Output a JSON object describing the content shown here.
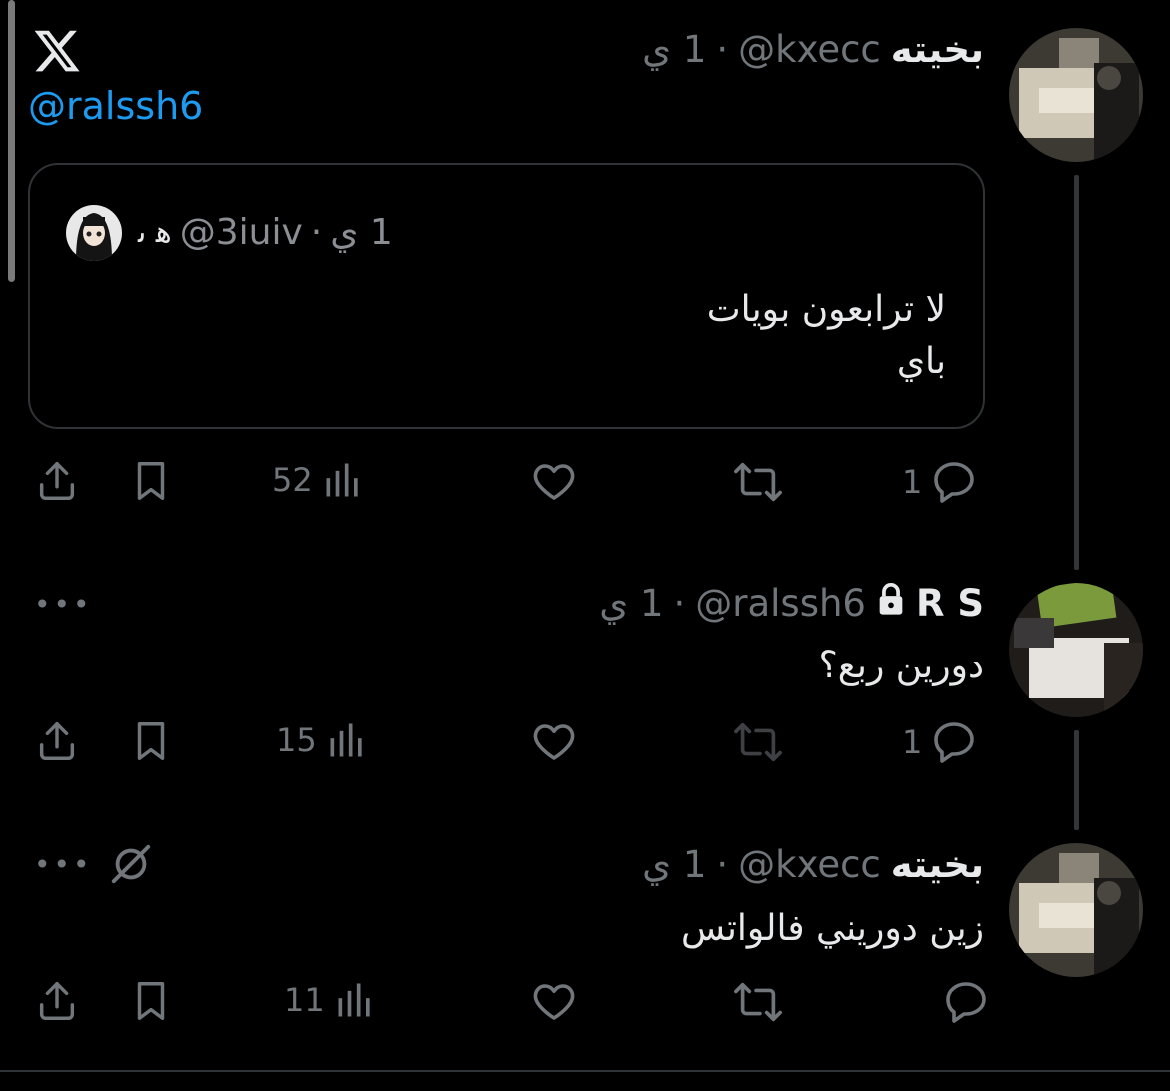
{
  "reply_to": "@ralssh6",
  "tweets": [
    {
      "display_name": "بخيته",
      "handle": "@kxecc",
      "separator": "·",
      "time": "1 ي",
      "quote": {
        "handle": "@3iuiv",
        "display_name": "ﻫ ﯨ",
        "time": "1 ي",
        "text": "لا ترابعون بويات\nباي"
      },
      "stats": {
        "replies": "1",
        "retweets": "",
        "likes": "",
        "views": "52"
      }
    },
    {
      "display_name": "R S",
      "handle": "@ralssh6",
      "separator": "·",
      "time": "1 ي",
      "protected": true,
      "text": "دورين ربع؟",
      "stats": {
        "replies": "1",
        "retweets": "",
        "likes": "",
        "views": "15"
      }
    },
    {
      "display_name": "بخيته",
      "handle": "@kxecc",
      "separator": "·",
      "time": "1 ي",
      "text": "زين دوريني فالواتس",
      "stats": {
        "replies": "",
        "retweets": "",
        "likes": "",
        "views": "11"
      }
    }
  ],
  "more_label": "•••",
  "icons": {
    "logo": "x-logo-icon",
    "reply": "reply-icon",
    "retweet": "retweet-icon",
    "like": "heart-icon",
    "views": "views-icon",
    "bookmark": "bookmark-icon",
    "share": "share-icon",
    "lock": "lock-icon",
    "muted": "no-grok-icon"
  },
  "colors": {
    "background": "#000000",
    "link": "#1d9bf0",
    "muted_text": "#71767b",
    "text": "#e7e9ea",
    "border": "#2f3336"
  }
}
